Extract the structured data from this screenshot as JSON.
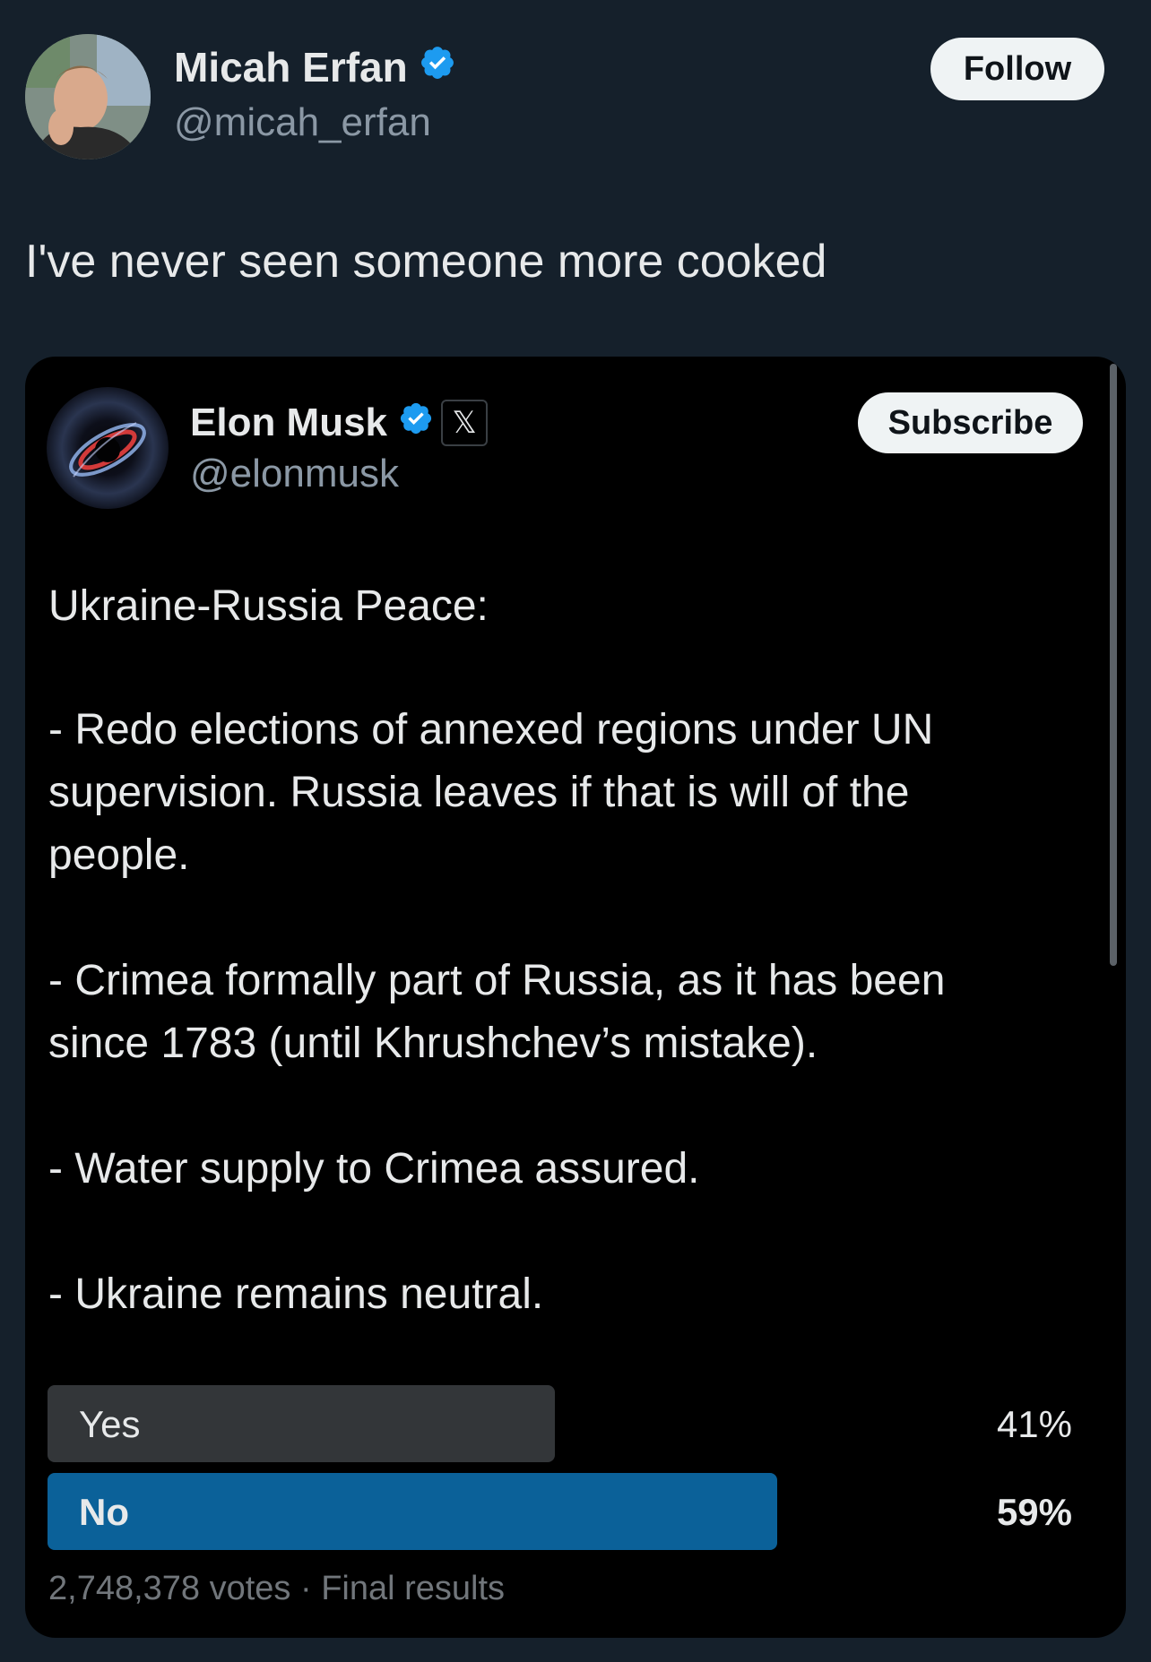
{
  "tweet": {
    "author_name": "Micah Erfan",
    "author_handle": "@micah_erfan",
    "follow_label": "Follow",
    "text": "I've never seen someone more cooked"
  },
  "quoted": {
    "author_name": "Elon Musk",
    "author_handle": "@elonmusk",
    "x_badge": "𝕏",
    "subscribe_label": "Subscribe",
    "lines": [
      "Ukraine-Russia Peace:",
      "- Redo elections of annexed regions under UN",
      "supervision. Russia leaves if that is will of the",
      "people.",
      "- Crimea formally part of Russia, as it has been",
      "since 1783 (until Khrushchev’s mistake).",
      "- Water supply to Crimea assured.",
      "- Ukraine remains neutral."
    ],
    "poll": {
      "options": [
        {
          "label": "Yes",
          "percent_text": "41%",
          "percent": 41
        },
        {
          "label": "No",
          "percent_text": "59%",
          "percent": 59
        }
      ],
      "footer": "2,748,378 votes · Final results"
    }
  },
  "colors": {
    "background": "#15202b",
    "card": "#000000",
    "verified": "#1d9bf0",
    "poll_winner": "#0b6199",
    "poll_other": "#333639"
  },
  "icons": {
    "verified": "verified-badge-icon",
    "x": "x-logo-icon"
  }
}
